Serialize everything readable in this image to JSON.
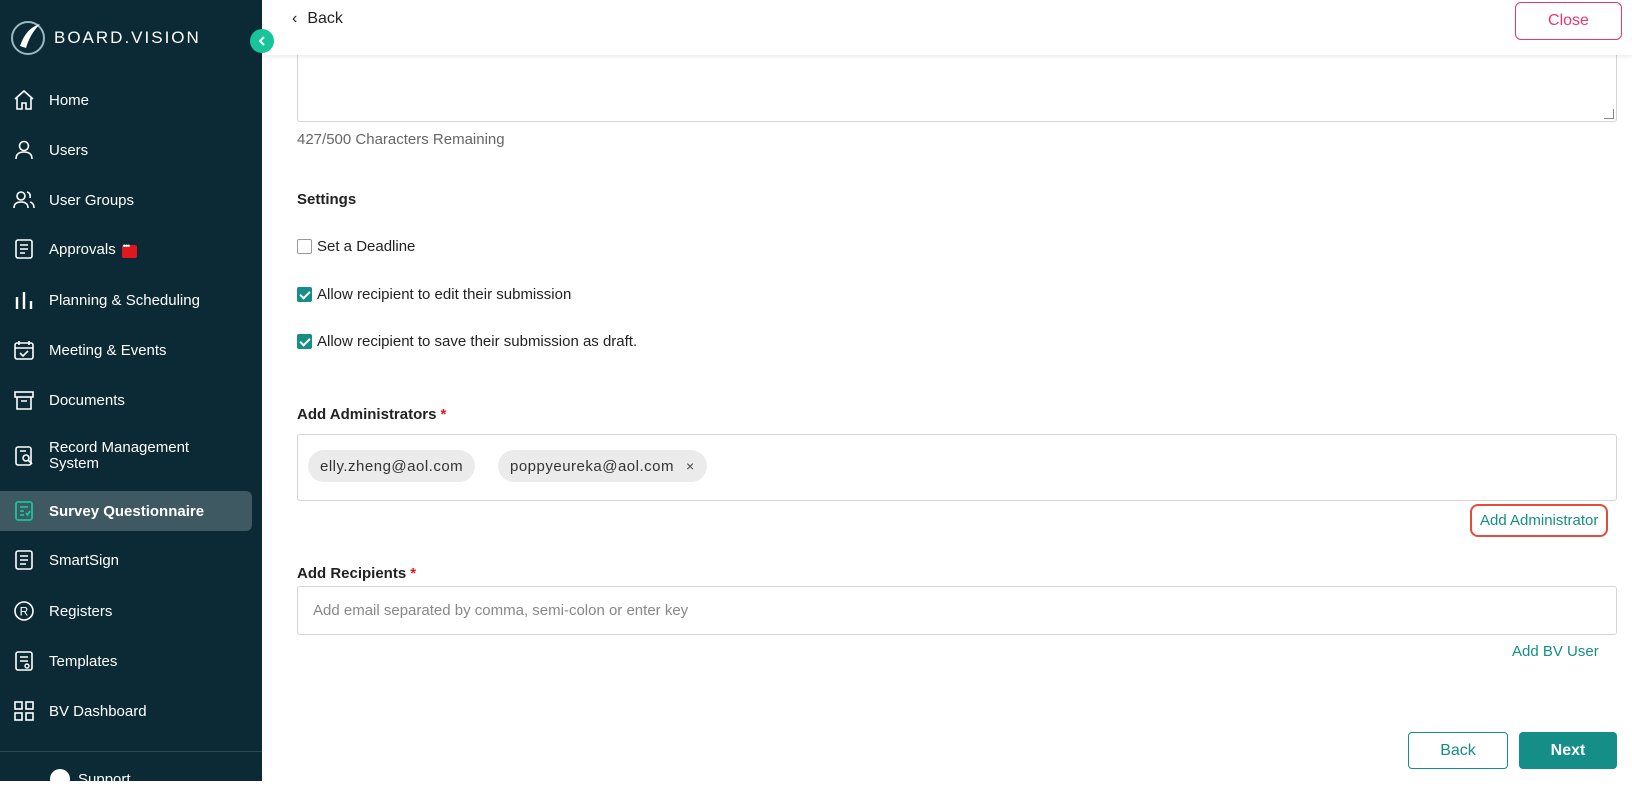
{
  "brand": {
    "name": "BOARD.VISION"
  },
  "sidebar": {
    "items": [
      {
        "label": "Home",
        "icon": "home-icon"
      },
      {
        "label": "Users",
        "icon": "user-icon"
      },
      {
        "label": "User Groups",
        "icon": "user-groups-icon"
      },
      {
        "label": "Approvals",
        "icon": "approvals-icon",
        "badge": "chat-badge"
      },
      {
        "label": "Planning & Scheduling",
        "icon": "bar-chart-icon"
      },
      {
        "label": "Meeting & Events",
        "icon": "calendar-check-icon"
      },
      {
        "label": "Documents",
        "icon": "archive-box-icon"
      },
      {
        "label_line1": "Record Management",
        "label_line2": "System",
        "icon": "record-search-icon"
      },
      {
        "label": "Survey Questionnaire",
        "icon": "survey-icon",
        "active": true
      },
      {
        "label": "SmartSign",
        "icon": "document-icon"
      },
      {
        "label": "Registers",
        "icon": "registered-icon"
      },
      {
        "label": "Templates",
        "icon": "template-icon"
      },
      {
        "label": "BV Dashboard",
        "icon": "grid-icon"
      }
    ],
    "support_label": "Support"
  },
  "header": {
    "back_label": "Back",
    "close_label": "Close"
  },
  "form": {
    "char_remaining": "427/500 Characters Remaining",
    "settings_title": "Settings",
    "settings": [
      {
        "label": "Set a Deadline",
        "checked": false
      },
      {
        "label": "Allow recipient to edit their submission",
        "checked": true
      },
      {
        "label": "Allow recipient to save their submission as draft.",
        "checked": true
      }
    ],
    "admins_title": "Add Administrators",
    "required_mark": "*",
    "admins": [
      "elly.zheng@aol.com",
      "poppyeureka@aol.com"
    ],
    "remove_glyph": "×",
    "add_admin_label": "Add Administrator",
    "recipients_title": "Add Recipients",
    "recipients_placeholder": "Add email separated by comma, semi-colon or enter key",
    "add_bv_user_label": "Add BV User",
    "back_button": "Back",
    "next_button": "Next"
  },
  "colors": {
    "sidebar_bg": "#0b2a35",
    "accent": "#148e86",
    "close": "#e6356f",
    "required": "#e0171f",
    "highlight": "#e34b3c"
  }
}
